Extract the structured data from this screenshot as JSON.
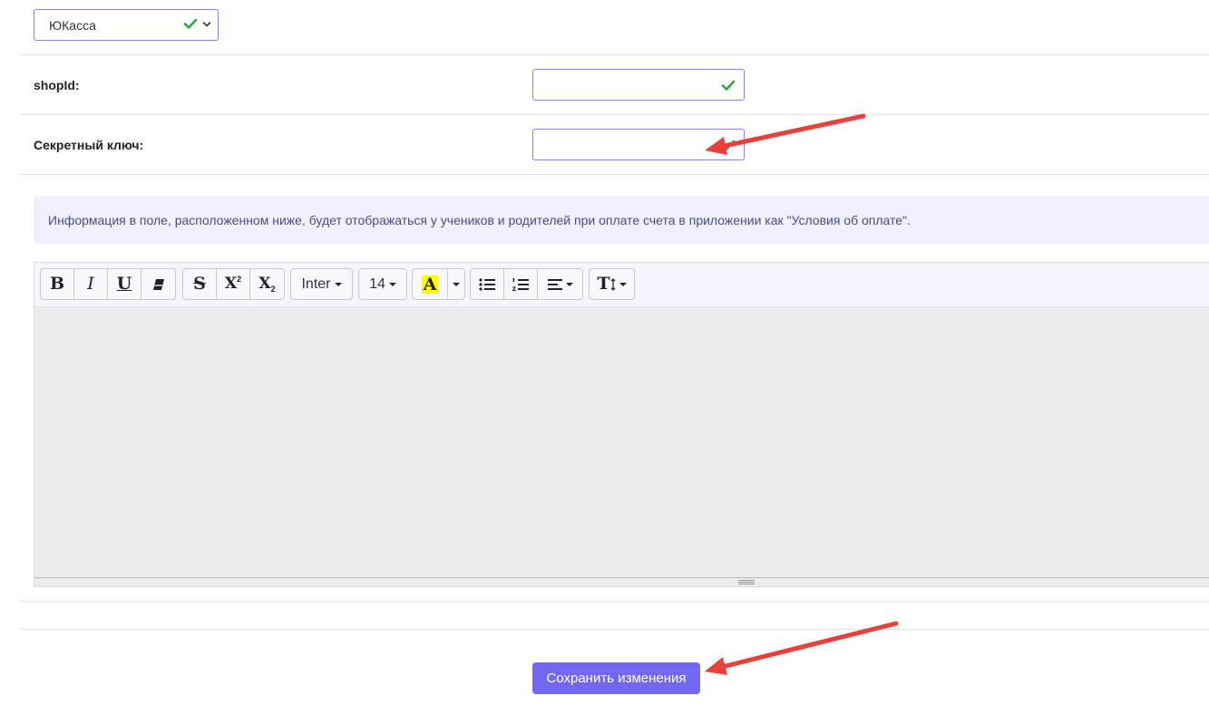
{
  "provider": {
    "selected": "ЮКасса"
  },
  "fields": {
    "shop_id": {
      "label": "shopId:",
      "value": ""
    },
    "secret_key": {
      "label": "Секретный ключ:",
      "value": ""
    }
  },
  "info_text": "Информация в поле, расположенном ниже, будет отображаться у учеников и родителей при оплате счета в приложении как \"Условия об оплате\".",
  "toolbar": {
    "bold": "B",
    "italic": "I",
    "underline": "U",
    "strike": "S",
    "superscript": "X",
    "subscript": "X",
    "font_family": "Inter",
    "font_size": "14",
    "color_letter": "A",
    "line_height": "T"
  },
  "editor": {
    "content": ""
  },
  "save_label": "Сохранить изменения",
  "colors": {
    "accent": "#7267ef",
    "valid_check": "#28a745",
    "annotation_arrow": "#e8413c",
    "highlight": "#ffff00"
  }
}
